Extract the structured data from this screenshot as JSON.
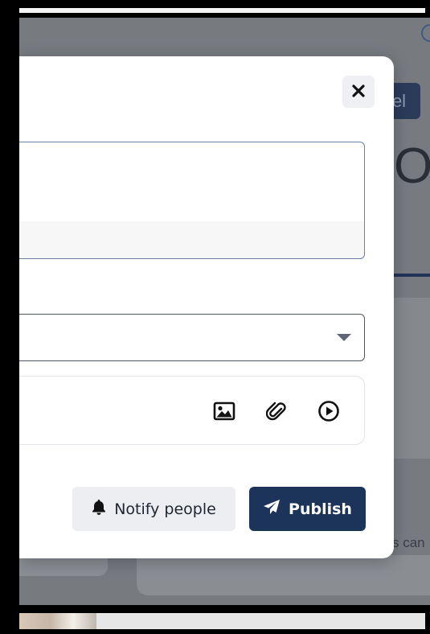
{
  "background": {
    "button_partial_label": "el",
    "big_letter": "O",
    "footer_partial_text": "s can"
  },
  "modal": {
    "close_icon": "close-icon",
    "textarea": {
      "value": ""
    },
    "select": {
      "value": "",
      "caret_icon": "caret-down-icon"
    },
    "attachments": {
      "icons": [
        "image-icon",
        "paperclip-icon",
        "play-circle-icon"
      ]
    },
    "actions": {
      "notify_label": "Notify people",
      "notify_icon": "bell-icon",
      "publish_label": "Publish",
      "publish_icon": "paper-plane-icon"
    }
  },
  "colors": {
    "primary": "#1d345a",
    "secondary_button": "#eceef2",
    "overlay": "#777b80"
  }
}
